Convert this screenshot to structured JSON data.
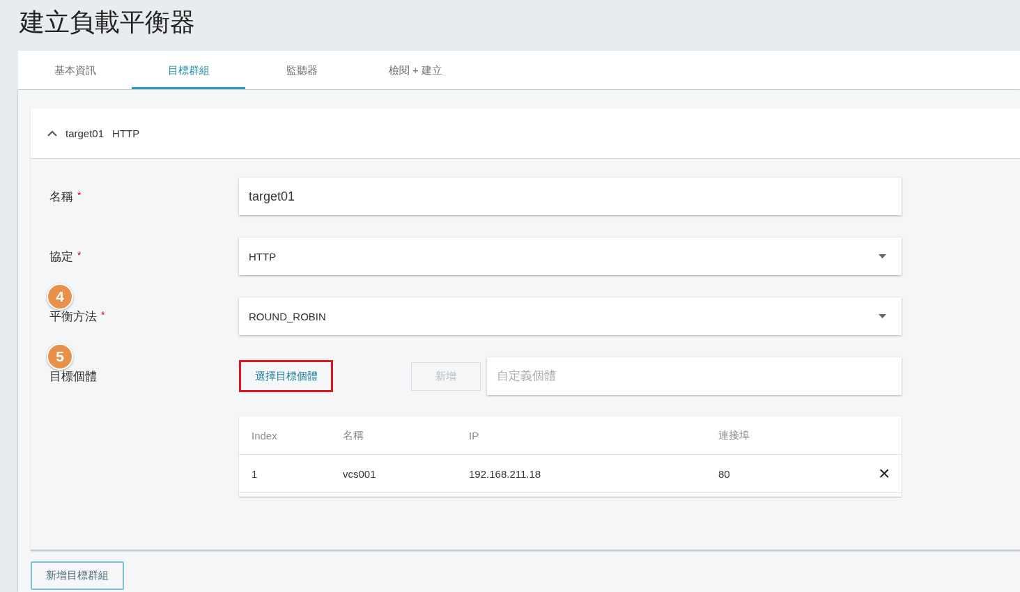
{
  "page_title": "建立負載平衡器",
  "tabs": [
    {
      "label": "基本資訊",
      "selected": false
    },
    {
      "label": "目標群組",
      "selected": true
    },
    {
      "label": "監聽器",
      "selected": false
    },
    {
      "label": "檢閱 + 建立",
      "selected": false
    }
  ],
  "target_group": {
    "expanded": true,
    "name": "target01",
    "protocol": "HTTP",
    "fields": [
      {
        "kind": "text",
        "label": "名稱",
        "required_mark": "*",
        "value": "target01"
      },
      {
        "kind": "select",
        "label": "協定",
        "required_mark": "*",
        "value": "HTTP"
      },
      {
        "kind": "select",
        "label": "平衡方法",
        "required_mark": "*",
        "value": "ROUND_ROBIN",
        "annotation": "4"
      },
      {
        "kind": "targets",
        "label": "目標個體",
        "annotation": "5",
        "select_button": {
          "label": "選擇目標個體",
          "highlighted": true
        },
        "add_button": {
          "label": "新增",
          "disabled": true
        },
        "custom_field": {
          "placeholder": "自定義個體"
        }
      }
    ],
    "table": {
      "columns": [
        "Index",
        "名稱",
        "IP",
        "連接埠"
      ],
      "rows": [
        {
          "cells": [
            "1",
            "vcs001",
            "192.168.211.18",
            "80"
          ],
          "remove_icon": "×"
        }
      ]
    }
  },
  "add_group_button": "新增目標群組"
}
